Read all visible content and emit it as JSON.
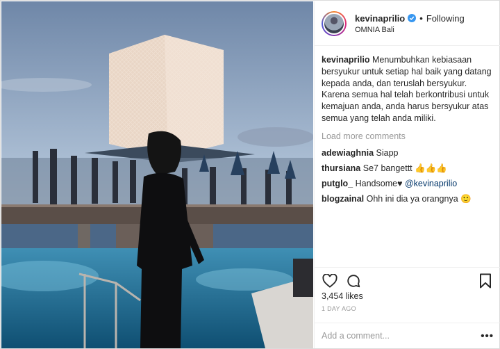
{
  "post": {
    "username": "kevinaprilio",
    "follow_status": "Following",
    "location": "OMNIA Bali",
    "verified_icon": "verified-badge-icon",
    "image_description_icon": "post-photo",
    "caption_user": "kevinaprilio",
    "caption_text": "Menumbuhkan kebiasaan bersyukur untuk setiap hal baik yang datang kepada anda, dan teruslah bersyukur. Karena semua hal telah berkontribusi untuk kemajuan anda, anda harus bersyukur atas semua yang telah anda miliki.",
    "load_more": "Load more comments",
    "comments": [
      {
        "user": "adewiaghnia",
        "text": "Siapp",
        "mention": ""
      },
      {
        "user": "thursiana",
        "text": "Se7 bangettt 👍👍👍",
        "mention": ""
      },
      {
        "user": "putglo_",
        "text": "Handsome♥",
        "mention": "@kevinaprilio"
      },
      {
        "user": "blogzainal",
        "text": "Ohh ini dia ya orangnya 🙂",
        "mention": ""
      }
    ],
    "likes": "3,454 likes",
    "time_ago": "1 DAY AGO",
    "comment_placeholder": "Add a comment...",
    "more_options": "•••"
  },
  "colors": {
    "verified": "#3897f0",
    "mention": "#003569",
    "muted": "#999999"
  }
}
